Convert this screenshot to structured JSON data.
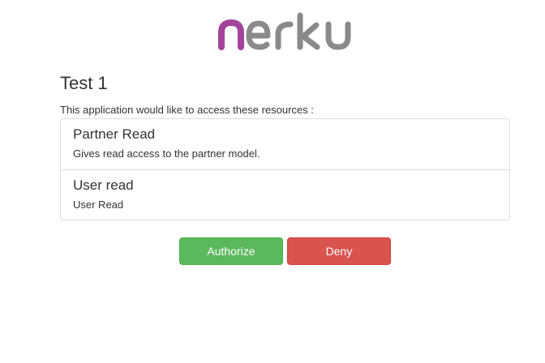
{
  "logo": {
    "text": "nerku",
    "colors": {
      "first_letter": "#a3449a",
      "rest": "#8a8a8a"
    }
  },
  "app": {
    "title": "Test 1"
  },
  "intro_text": "This application would like to access these resources :",
  "resources": [
    {
      "name": "Partner Read",
      "description": "Gives read access to the partner model."
    },
    {
      "name": "User read",
      "description": "User Read"
    }
  ],
  "actions": {
    "authorize_label": "Authorize",
    "deny_label": "Deny"
  },
  "colors": {
    "authorize": "#5cb85c",
    "deny": "#d9534f",
    "text": "#333333",
    "border": "#dddddd"
  }
}
